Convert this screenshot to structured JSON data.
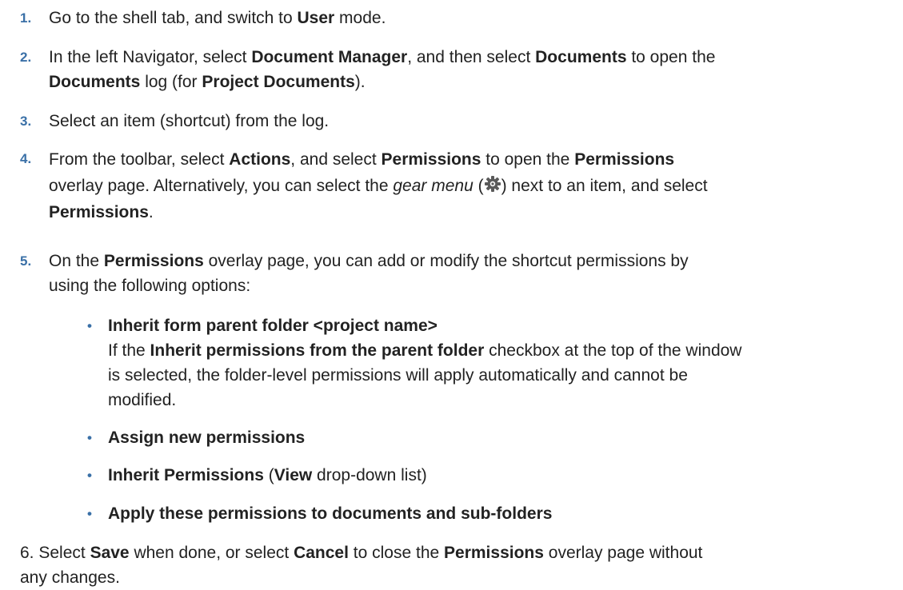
{
  "steps": [
    {
      "num": "1.",
      "parts": [
        "Go to the shell tab, and switch to ",
        "User",
        " mode."
      ]
    },
    {
      "num": "2.",
      "parts": [
        "In the left Navigator, select ",
        "Document Manager",
        ", and then select ",
        "Documents",
        " to open the",
        "Documents",
        " log (for ",
        "Project Documents",
        ")."
      ]
    },
    {
      "num": "3.",
      "parts": [
        "Select an item (shortcut) from the log."
      ]
    },
    {
      "num": "4.",
      "parts": [
        "From the toolbar, select ",
        "Actions",
        ", and select ",
        "Permissions",
        " to open the ",
        "Permissions",
        "overlay page. Alternatively, you can select the ",
        "gear menu",
        " (",
        ") next to an item, and select",
        "Permissions",
        "."
      ]
    },
    {
      "num": "5.",
      "parts": [
        "On the ",
        "Permissions",
        " overlay page, you can add or modify the shortcut permissions by",
        "using the following options:"
      ]
    }
  ],
  "options": [
    {
      "title": "Inherit form parent folder <project name>",
      "desc": [
        "If the ",
        "Inherit permissions from the parent folder",
        " checkbox at the top of the window",
        "is selected, the folder-level permissions will apply automatically and cannot be",
        "modified."
      ]
    },
    {
      "title": "Assign new permissions"
    },
    {
      "title": "Inherit Permissions",
      "after": [
        " (",
        "View",
        " drop-down list)"
      ]
    },
    {
      "title": "Apply these permissions to documents and sub-folders"
    }
  ],
  "final": [
    "6. Select ",
    "Save",
    " when done, or select ",
    "Cancel",
    " to close the ",
    "Permissions",
    " overlay page without",
    "any changes."
  ],
  "bullet": "•",
  "icons": {
    "gear": "gear-icon"
  },
  "colors": {
    "number": "#3a70a7",
    "text": "#222222"
  }
}
